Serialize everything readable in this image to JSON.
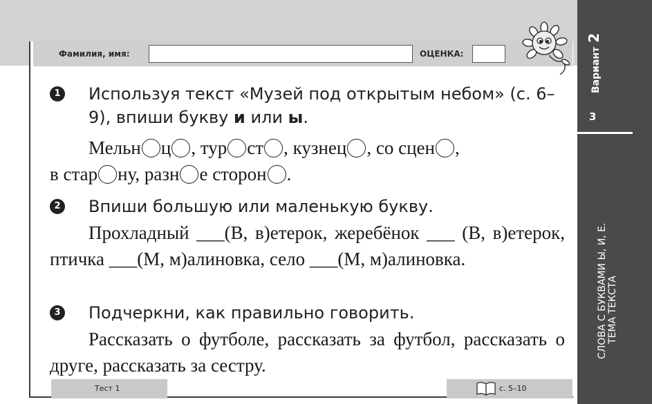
{
  "header": {
    "name_label": "Фамилия, имя:",
    "grade_label": "ОЦЕНКА:"
  },
  "side": {
    "variant_word": "Вариант",
    "variant_number": "2",
    "page_number": "3",
    "topic_line1": "СЛОВА С БУКВАМИ Ы, И, Е.",
    "topic_line2": "ТЕМА ТЕКСТА"
  },
  "tasks": [
    {
      "number": "1",
      "instruction": "Используя текст «Музей под открытым небом» (с. 6–9), впиши букву ",
      "instruction_b1": "и",
      "instruction_mid": " или ",
      "instruction_b2": "ы",
      "instruction_end": ".",
      "segments": [
        "Мельн",
        "ц",
        ", тур",
        "ст",
        ", кузнец",
        ", со сцен",
        ",",
        "в стар",
        "ну, разн",
        "е сторон",
        "."
      ]
    },
    {
      "number": "2",
      "instruction": "Впиши большую или маленькую букву.",
      "text": "Прохладный ___(В, в)етерок, жеребёнок ___ (В, в)етерок, птичка ___(М, м)алиновка, село ___(М, м)алиновка."
    },
    {
      "number": "3",
      "instruction": "Подчеркни, как правильно говорить.",
      "text": "Рассказать о футболе, рассказать за футбол, рассказать о друге, рассказать за сестру."
    }
  ],
  "footer": {
    "test_label": "Тест 1",
    "pages_ref": "с. 5–10"
  },
  "colors": {
    "top_band": "#d2d2d2",
    "side_strip": "#4a4a4a",
    "number_badge": "#222222"
  },
  "icons": [
    "sunflower-mascot-icon",
    "open-book-icon"
  ]
}
